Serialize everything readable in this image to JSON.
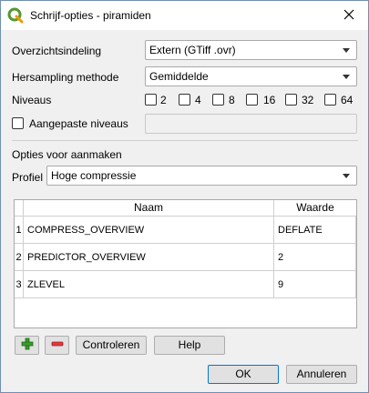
{
  "window": {
    "title": "Schrijf-opties - piramiden",
    "app_icon": "qgis-icon",
    "close_icon": "close-icon"
  },
  "form": {
    "overview_format_label": "Overzichtsindeling",
    "overview_format_value": "Extern (GTiff .ovr)",
    "resampling_label": "Hersampling methode",
    "resampling_value": "Gemiddelde",
    "levels_label": "Niveaus",
    "levels": [
      "2",
      "4",
      "8",
      "16",
      "32",
      "64"
    ],
    "custom_levels_label": "Aangepaste niveaus"
  },
  "creation_options": {
    "section_label": "Opties voor aanmaken",
    "profile_label": "Profiel",
    "profile_value": "Hoge compressie",
    "table": {
      "headers": [
        "Naam",
        "Waarde"
      ],
      "rows": [
        {
          "index": "1",
          "name": "COMPRESS_OVERVIEW",
          "value": "DEFLATE"
        },
        {
          "index": "2",
          "name": "PREDICTOR_OVERVIEW",
          "value": "2"
        },
        {
          "index": "3",
          "name": "ZLEVEL",
          "value": "9"
        }
      ]
    },
    "add_icon": "plus-icon",
    "remove_icon": "minus-icon",
    "validate_label": "Controleren",
    "help_label": "Help"
  },
  "footer": {
    "ok_label": "OK",
    "cancel_label": "Annuleren"
  },
  "colors": {
    "accent": "#0078d7",
    "add_icon": "#3a9b2e",
    "remove_icon": "#e0393e"
  }
}
